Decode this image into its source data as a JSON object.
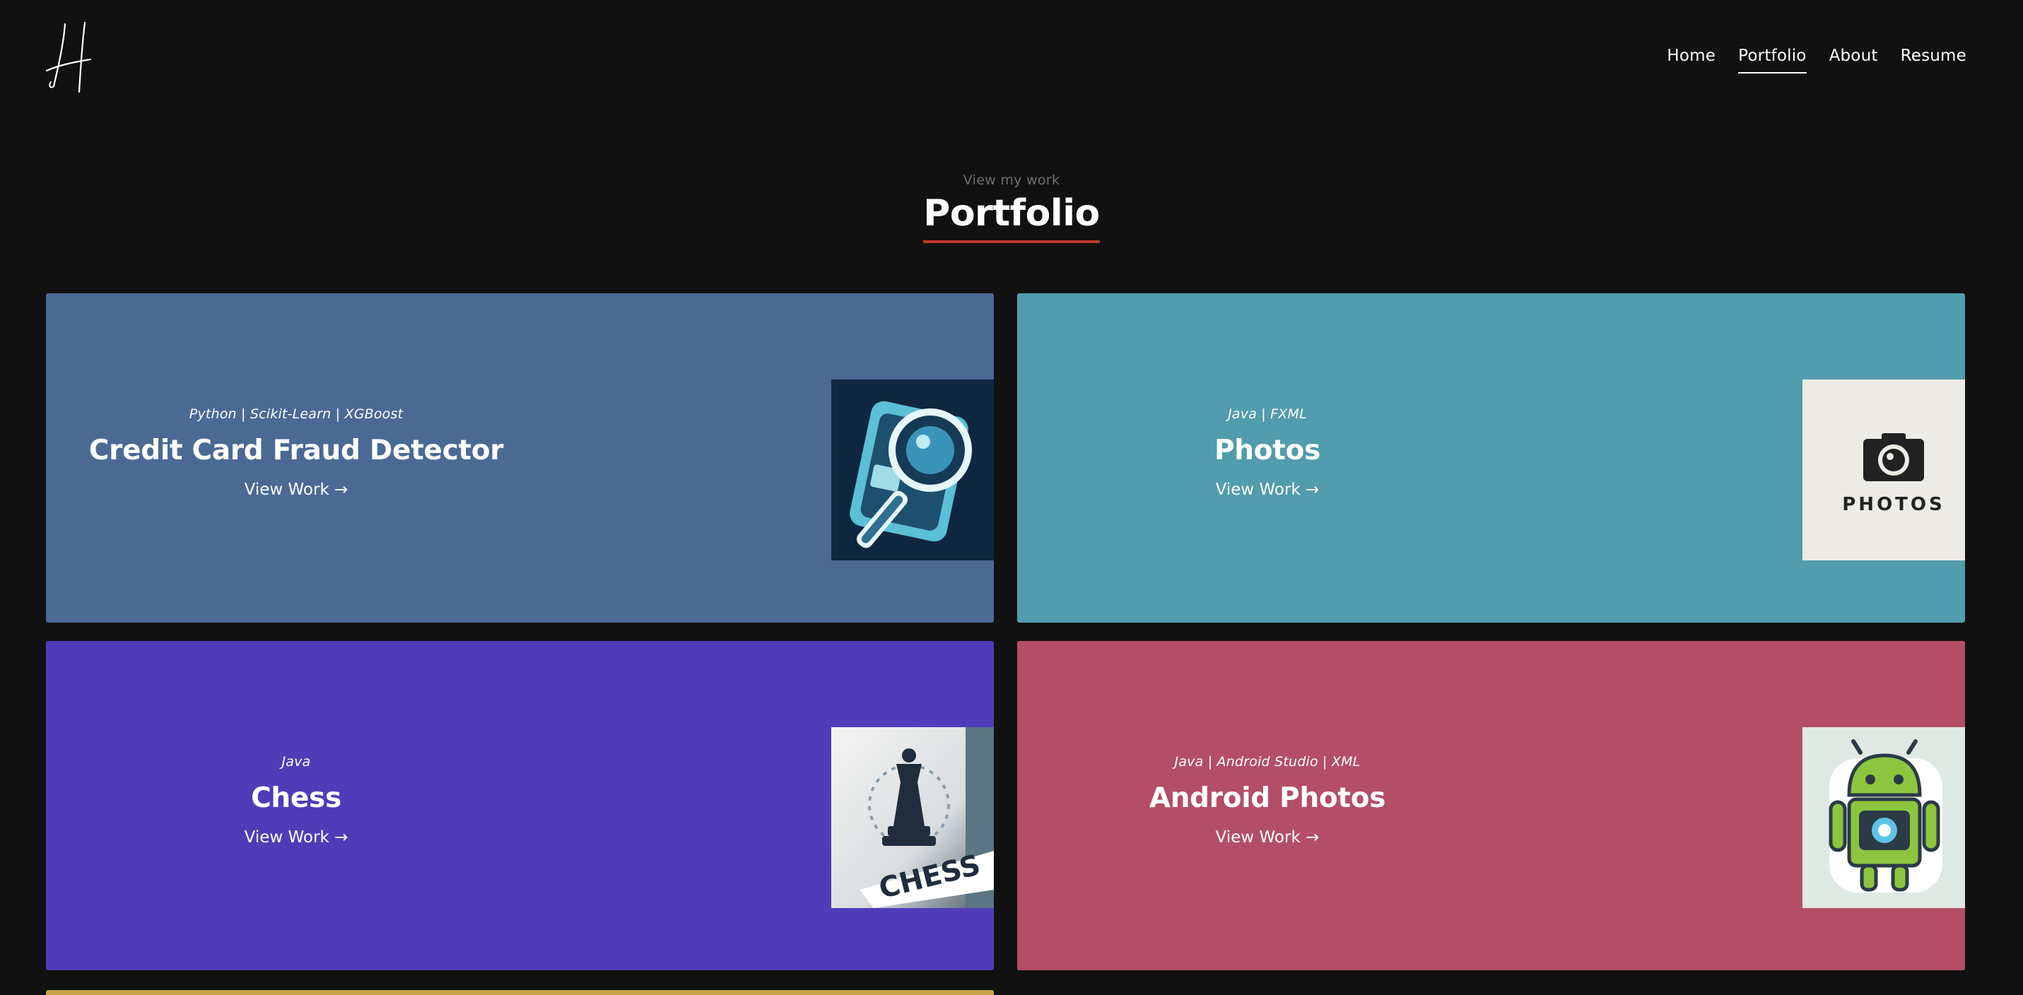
{
  "nav": {
    "items": [
      {
        "label": "Home",
        "active": false
      },
      {
        "label": "Portfolio",
        "active": true
      },
      {
        "label": "About",
        "active": false
      },
      {
        "label": "Resume",
        "active": false
      }
    ]
  },
  "section": {
    "kicker": "View my work",
    "title": "Portfolio",
    "accent_color": "#c0392b"
  },
  "projects": [
    {
      "tech": "Python | Scikit-Learn | XGBoost",
      "name": "Credit Card Fraud Detector",
      "link": "View Work →",
      "color": "#4a6a94",
      "thumbnail_icon": "credit-card-magnifier-icon"
    },
    {
      "tech": "Java | FXML",
      "name": "Photos",
      "link": "View Work →",
      "color": "#519cad",
      "thumbnail_icon": "camera-photos-logo-icon",
      "thumbnail_text": "PHOTOS"
    },
    {
      "tech": "Java",
      "name": "Chess",
      "link": "View Work →",
      "color": "#503cb8",
      "thumbnail_icon": "chess-queen-logo-icon",
      "thumbnail_text": "CHESS"
    },
    {
      "tech": "Java | Android Studio | XML",
      "name": "Android Photos",
      "link": "View Work →",
      "color": "#b44e67",
      "thumbnail_icon": "android-camera-icon"
    }
  ],
  "next_card_color": "#c9a34a"
}
